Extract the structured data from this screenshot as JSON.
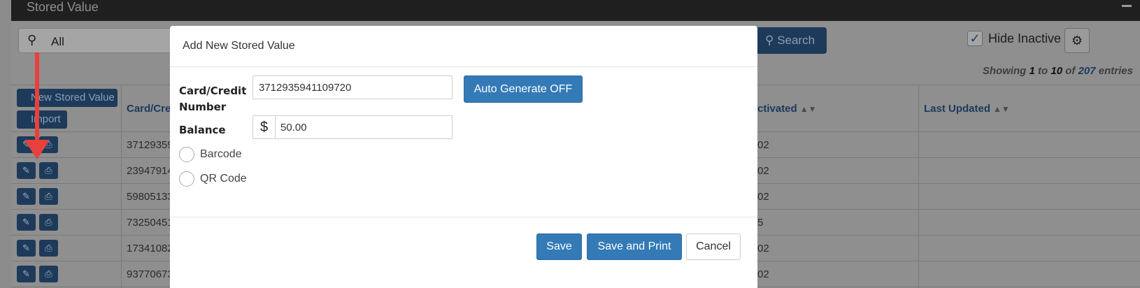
{
  "page": {
    "title": "Stored Value"
  },
  "toolbar": {
    "search_value": "All",
    "search_label": "Search",
    "hide_inactive_label": "Hide Inactive",
    "hide_inactive_checked": true
  },
  "showing": {
    "prefix": "Showing",
    "from": "1",
    "to_word": "to",
    "to": "10",
    "of_word": "of",
    "total": "207",
    "suffix": "entries"
  },
  "table": {
    "new_button": "New Stored Value",
    "import_button": "Import",
    "columns": [
      "Card/Cre",
      "ctivated",
      "Last Updated"
    ],
    "rows": [
      {
        "card": "37129359",
        "activated": "02"
      },
      {
        "card": "23947914",
        "activated": "02"
      },
      {
        "card": "59805133",
        "activated": "02"
      },
      {
        "card": "73250451",
        "activated": "5"
      },
      {
        "card": "17341082",
        "activated": "02"
      },
      {
        "card": "93770673",
        "activated": "02"
      }
    ]
  },
  "modal": {
    "title": "Add New Stored Value",
    "card_label_1": "Card/Credit",
    "card_label_2": "Number",
    "card_value": "3712935941109720",
    "auto_generate": "Auto Generate OFF",
    "balance_label": "Balance",
    "currency": "$",
    "balance_value": "50.00",
    "options": [
      "Barcode",
      "QR Code"
    ],
    "save": "Save",
    "save_print": "Save and Print",
    "cancel": "Cancel"
  },
  "colors": {
    "primary": "#337ab7",
    "arrow": "#e8403c"
  }
}
